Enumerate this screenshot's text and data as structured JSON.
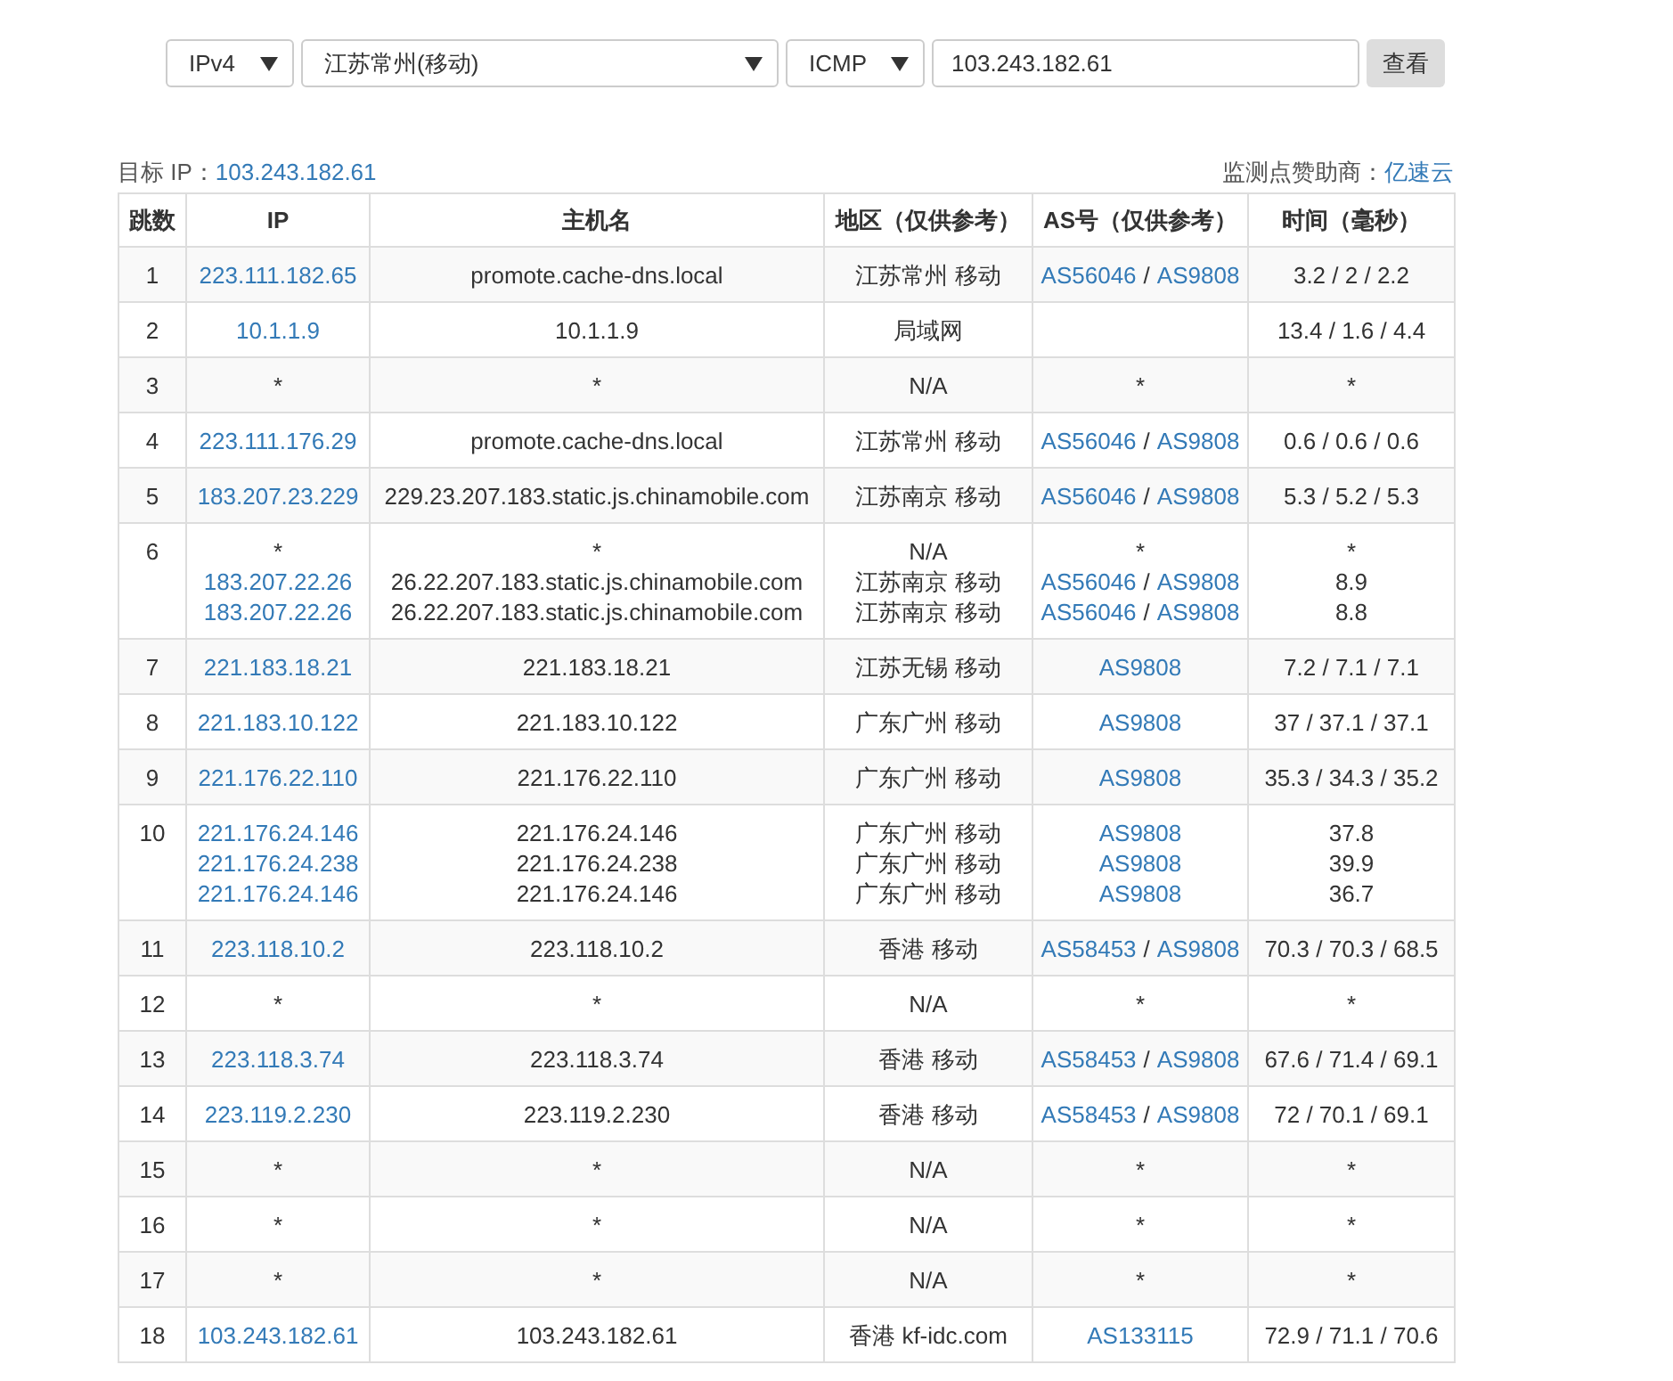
{
  "query": {
    "protocol_version": "IPv4",
    "node": "江苏常州(移动)",
    "method": "ICMP",
    "target": "103.243.182.61",
    "submit": "查看"
  },
  "target_info": {
    "label": "目标 IP：",
    "ip": "103.243.182.61"
  },
  "sponsor": {
    "label": "监测点赞助商：",
    "name": "亿速云"
  },
  "table": {
    "as_separator": "/",
    "columns": [
      "跳数",
      "IP",
      "主机名",
      "地区（仅供参考）",
      "AS号（仅供参考）",
      "时间（毫秒）"
    ],
    "rows": [
      {
        "hop": "1",
        "entries": [
          {
            "kind": "reply",
            "ip": "223.111.182.65",
            "host": "promote.cache-dns.local",
            "region": "江苏常州 移动",
            "as": [
              "AS56046",
              "AS9808"
            ],
            "time": "3.2 / 2 / 2.2"
          }
        ]
      },
      {
        "hop": "2",
        "entries": [
          {
            "kind": "reply",
            "ip": "10.1.1.9",
            "host": "10.1.1.9",
            "region": "局域网",
            "time": "13.4 / 1.6 / 4.4"
          }
        ]
      },
      {
        "hop": "3",
        "entries": [
          {
            "kind": "timeout",
            "ip": "*",
            "host": "*",
            "region": "N/A",
            "as": [
              "*"
            ],
            "time": "*"
          }
        ]
      },
      {
        "hop": "4",
        "entries": [
          {
            "kind": "reply",
            "ip": "223.111.176.29",
            "host": "promote.cache-dns.local",
            "region": "江苏常州 移动",
            "as": [
              "AS56046",
              "AS9808"
            ],
            "time": "0.6 / 0.6 / 0.6"
          }
        ]
      },
      {
        "hop": "5",
        "entries": [
          {
            "kind": "reply",
            "ip": "183.207.23.229",
            "host": "229.23.207.183.static.js.chinamobile.com",
            "region": "江苏南京 移动",
            "as": [
              "AS56046",
              "AS9808"
            ],
            "time": "5.3 / 5.2 / 5.3"
          }
        ]
      },
      {
        "hop": "6",
        "entries": [
          {
            "kind": "timeout",
            "ip": "*",
            "host": "*",
            "region": "N/A",
            "as": [
              "*"
            ],
            "time": "*"
          },
          {
            "kind": "reply",
            "ip": "183.207.22.26",
            "host": "26.22.207.183.static.js.chinamobile.com",
            "region": "江苏南京 移动",
            "as": [
              "AS56046",
              "AS9808"
            ],
            "time": "8.9"
          },
          {
            "kind": "reply",
            "ip": "183.207.22.26",
            "host": "26.22.207.183.static.js.chinamobile.com",
            "region": "江苏南京 移动",
            "as": [
              "AS56046",
              "AS9808"
            ],
            "time": "8.8"
          }
        ]
      },
      {
        "hop": "7",
        "entries": [
          {
            "kind": "reply",
            "ip": "221.183.18.21",
            "host": "221.183.18.21",
            "region": "江苏无锡 移动",
            "as": [
              "AS9808"
            ],
            "time": "7.2 / 7.1 / 7.1"
          }
        ]
      },
      {
        "hop": "8",
        "entries": [
          {
            "kind": "reply",
            "ip": "221.183.10.122",
            "host": "221.183.10.122",
            "region": "广东广州 移动",
            "as": [
              "AS9808"
            ],
            "time": "37 / 37.1 / 37.1"
          }
        ]
      },
      {
        "hop": "9",
        "entries": [
          {
            "kind": "reply",
            "ip": "221.176.22.110",
            "host": "221.176.22.110",
            "region": "广东广州 移动",
            "as": [
              "AS9808"
            ],
            "time": "35.3 / 34.3 / 35.2"
          }
        ]
      },
      {
        "hop": "10",
        "entries": [
          {
            "kind": "reply",
            "ip": "221.176.24.146",
            "host": "221.176.24.146",
            "region": "广东广州 移动",
            "as": [
              "AS9808"
            ],
            "time": "37.8"
          },
          {
            "kind": "reply",
            "ip": "221.176.24.238",
            "host": "221.176.24.238",
            "region": "广东广州 移动",
            "as": [
              "AS9808"
            ],
            "time": "39.9"
          },
          {
            "kind": "reply",
            "ip": "221.176.24.146",
            "host": "221.176.24.146",
            "region": "广东广州 移动",
            "as": [
              "AS9808"
            ],
            "time": "36.7"
          }
        ]
      },
      {
        "hop": "11",
        "entries": [
          {
            "kind": "reply",
            "ip": "223.118.10.2",
            "host": "223.118.10.2",
            "region": "香港 移动",
            "as": [
              "AS58453",
              "AS9808"
            ],
            "time": "70.3 / 70.3 / 68.5"
          }
        ]
      },
      {
        "hop": "12",
        "entries": [
          {
            "kind": "timeout",
            "ip": "*",
            "host": "*",
            "region": "N/A",
            "as": [
              "*"
            ],
            "time": "*"
          }
        ]
      },
      {
        "hop": "13",
        "entries": [
          {
            "kind": "reply",
            "ip": "223.118.3.74",
            "host": "223.118.3.74",
            "region": "香港 移动",
            "as": [
              "AS58453",
              "AS9808"
            ],
            "time": "67.6 / 71.4 / 69.1"
          }
        ]
      },
      {
        "hop": "14",
        "entries": [
          {
            "kind": "reply",
            "ip": "223.119.2.230",
            "host": "223.119.2.230",
            "region": "香港 移动",
            "as": [
              "AS58453",
              "AS9808"
            ],
            "time": "72 / 70.1 / 69.1"
          }
        ]
      },
      {
        "hop": "15",
        "entries": [
          {
            "kind": "timeout",
            "ip": "*",
            "host": "*",
            "region": "N/A",
            "as": [
              "*"
            ],
            "time": "*"
          }
        ]
      },
      {
        "hop": "16",
        "entries": [
          {
            "kind": "timeout",
            "ip": "*",
            "host": "*",
            "region": "N/A",
            "as": [
              "*"
            ],
            "time": "*"
          }
        ]
      },
      {
        "hop": "17",
        "entries": [
          {
            "kind": "timeout",
            "ip": "*",
            "host": "*",
            "region": "N/A",
            "as": [
              "*"
            ],
            "time": "*"
          }
        ]
      },
      {
        "hop": "18",
        "entries": [
          {
            "kind": "reply",
            "ip": "103.243.182.61",
            "host": "103.243.182.61",
            "region": "香港 kf-idc.com",
            "as": [
              "AS133115"
            ],
            "time": "72.9 / 71.1 / 70.6"
          }
        ]
      }
    ]
  }
}
